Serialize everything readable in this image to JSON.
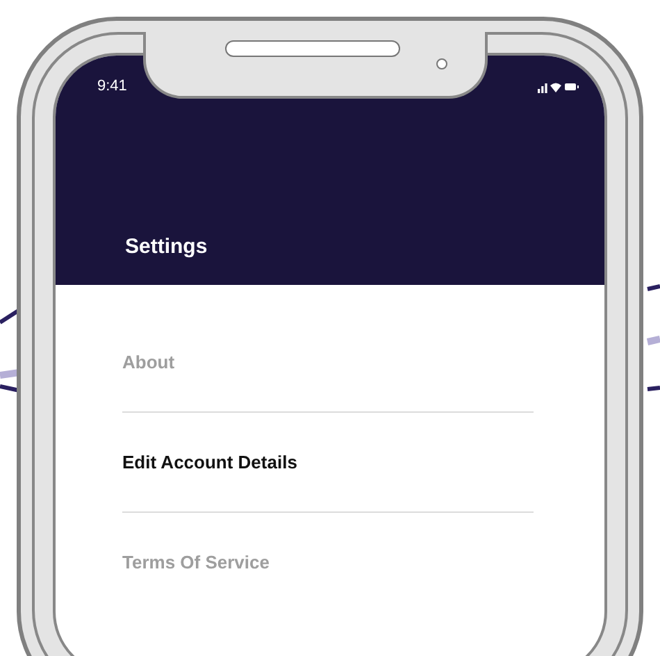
{
  "status_bar": {
    "time": "9:41"
  },
  "header": {
    "title": "Settings"
  },
  "menu_items": [
    {
      "label": "About",
      "selected": false
    },
    {
      "label": "Edit Account Details",
      "selected": true
    },
    {
      "label": "Terms Of Service",
      "selected": false
    }
  ]
}
